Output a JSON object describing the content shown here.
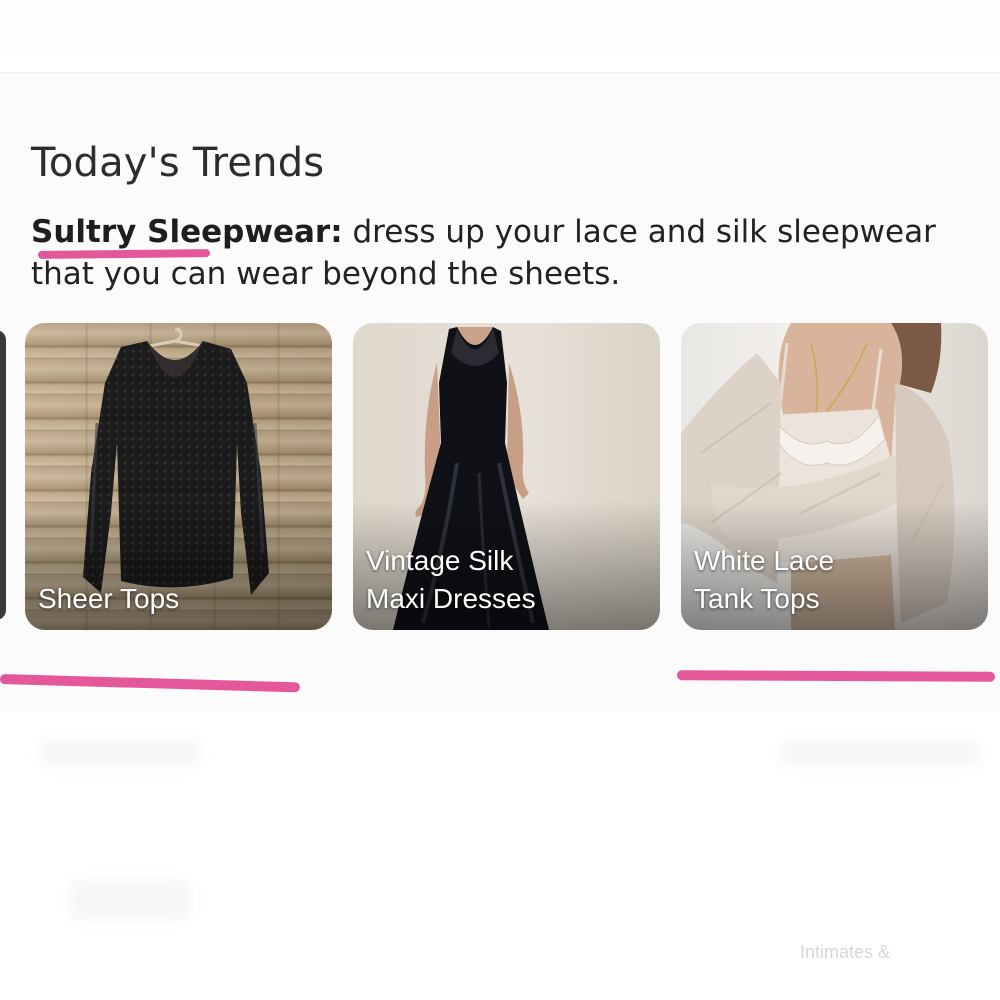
{
  "section": {
    "title": "Today's Trends",
    "highlight": "Sultry Sleepwear:",
    "description": " dress up your lace and silk sleepwear that you can wear beyond the sheets."
  },
  "cards": [
    {
      "label": "Sheer Tops",
      "icon": "sheer-lace-top-image"
    },
    {
      "label": "Vintage Silk Maxi Dresses",
      "icon": "silk-maxi-dress-image"
    },
    {
      "label": "White Lace Tank Tops",
      "icon": "lace-cami-image"
    }
  ],
  "footer": {
    "faint_label": "Intimates &"
  },
  "colors": {
    "annotation_pink": "#e4589b",
    "title_text": "#2d2d2d",
    "body_text": "#222222"
  }
}
